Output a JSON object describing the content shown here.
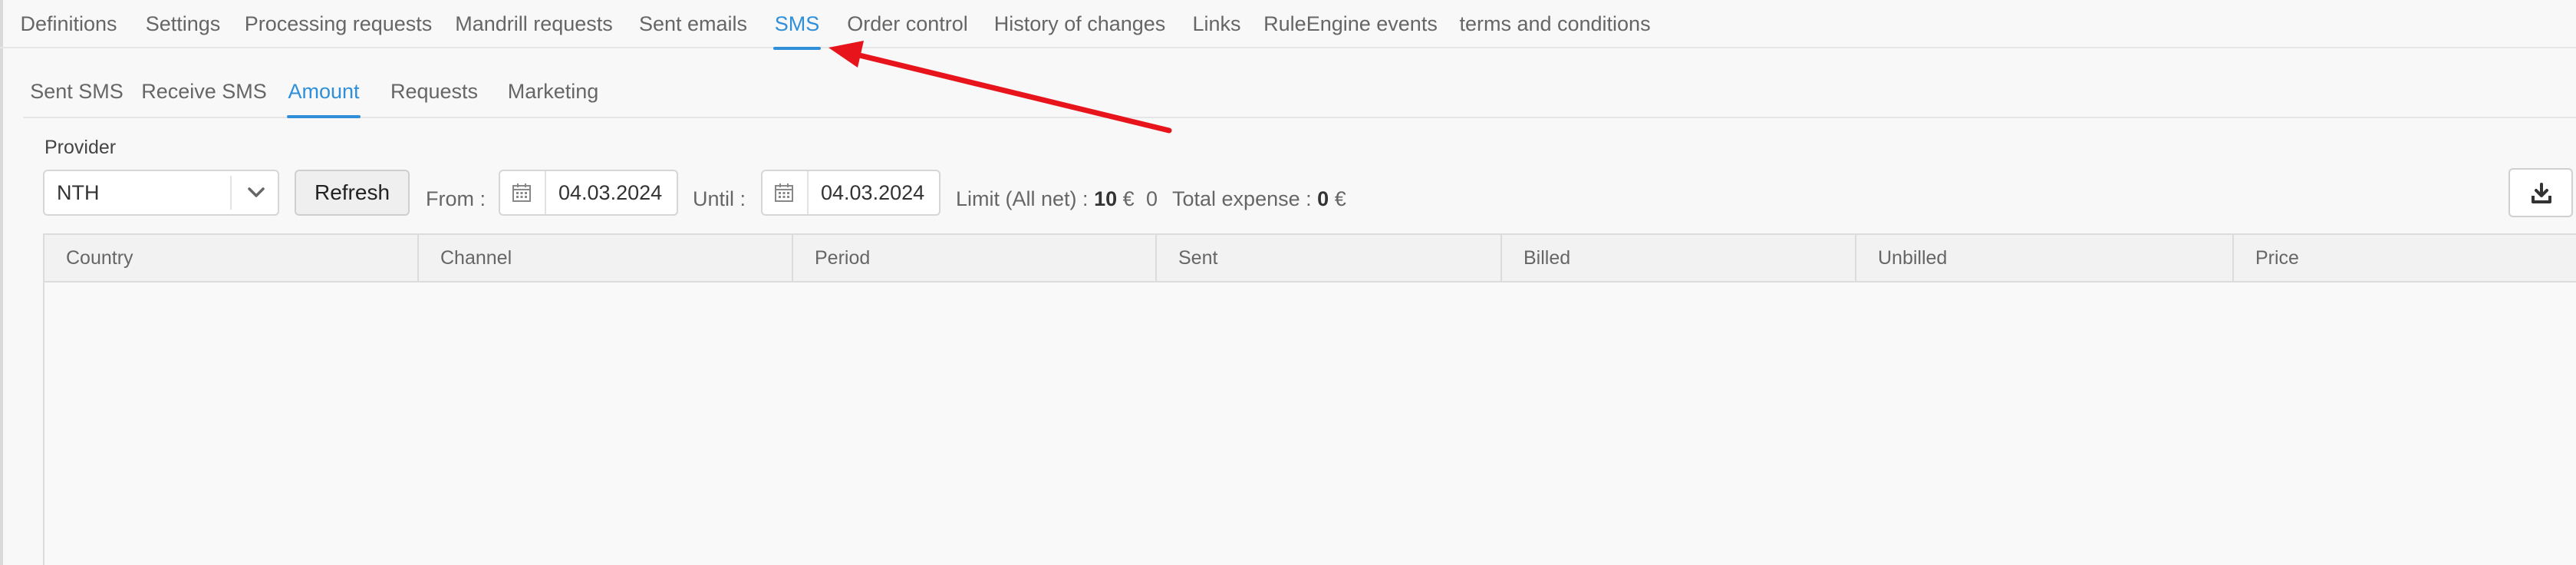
{
  "top_tabs": [
    {
      "label": "Definitions"
    },
    {
      "label": "Settings"
    },
    {
      "label": "Processing requests"
    },
    {
      "label": "Mandrill requests"
    },
    {
      "label": "Sent emails"
    },
    {
      "label": "SMS",
      "active": true
    },
    {
      "label": "Order control"
    },
    {
      "label": "History of changes"
    },
    {
      "label": "Links"
    },
    {
      "label": "RuleEngine events"
    },
    {
      "label": "terms and conditions"
    }
  ],
  "sub_tabs": [
    {
      "label": "Sent SMS"
    },
    {
      "label": "Receive SMS"
    },
    {
      "label": "Amount",
      "active": true
    },
    {
      "label": "Requests"
    },
    {
      "label": "Marketing"
    }
  ],
  "controls": {
    "provider_label": "Provider",
    "provider_value": "NTH",
    "refresh_label": "Refresh",
    "from_label": "From :",
    "from_date": "04.03.2024",
    "until_label": "Until :",
    "until_date": "04.03.2024",
    "limit_label": "Limit (All net) :",
    "limit_value": "10",
    "currency": "€",
    "count_value": "0",
    "total_label": "Total expense :",
    "total_value": "0"
  },
  "table": {
    "columns": [
      "Country",
      "Channel",
      "Period",
      "Sent",
      "Billed",
      "Unbilled",
      "Price"
    ]
  },
  "icons": {
    "chevron": "chevron-down-icon",
    "calendar": "calendar-icon",
    "download": "download-icon"
  },
  "colors": {
    "accent": "#2f8fd8",
    "annotation_arrow": "#e8141b"
  }
}
